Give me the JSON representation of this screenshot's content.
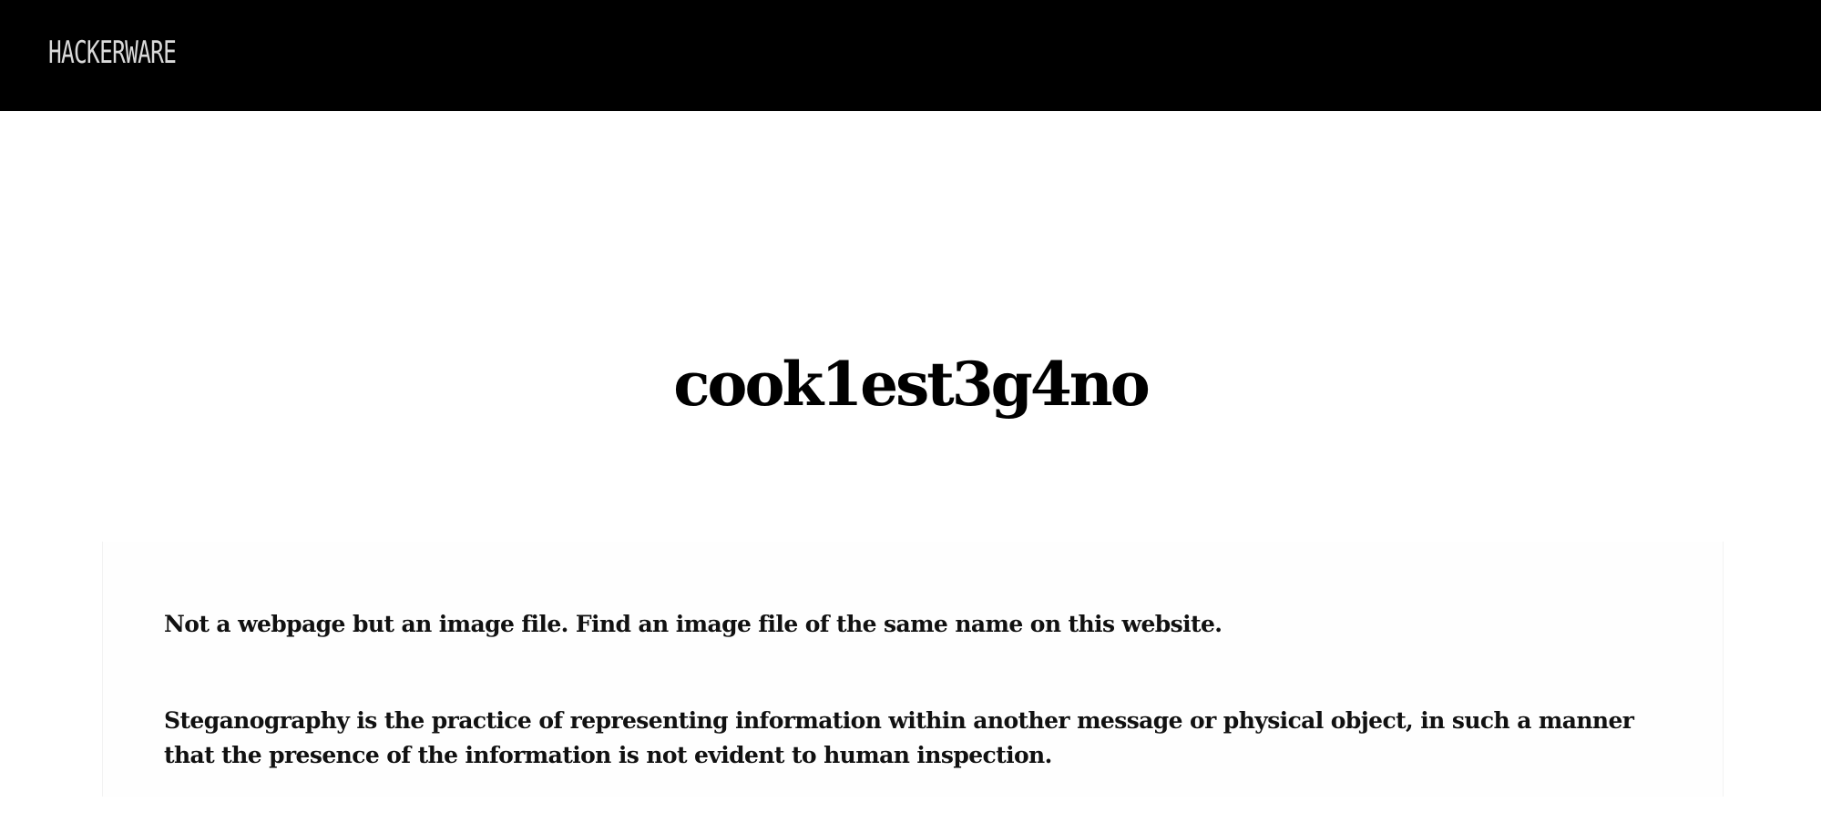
{
  "header": {
    "logo_text": "HACKERWARE",
    "background_color": "#000000",
    "logo_color": "#d9d9d9"
  },
  "main": {
    "title": "cook1est3g4no",
    "paragraphs": [
      "Not a webpage but an image file. Find an image file of the same name on this website.",
      "Steganography is the practice of representing information within another message or physical object, in such a manner that the presence of the information is not evident to human inspection."
    ]
  }
}
